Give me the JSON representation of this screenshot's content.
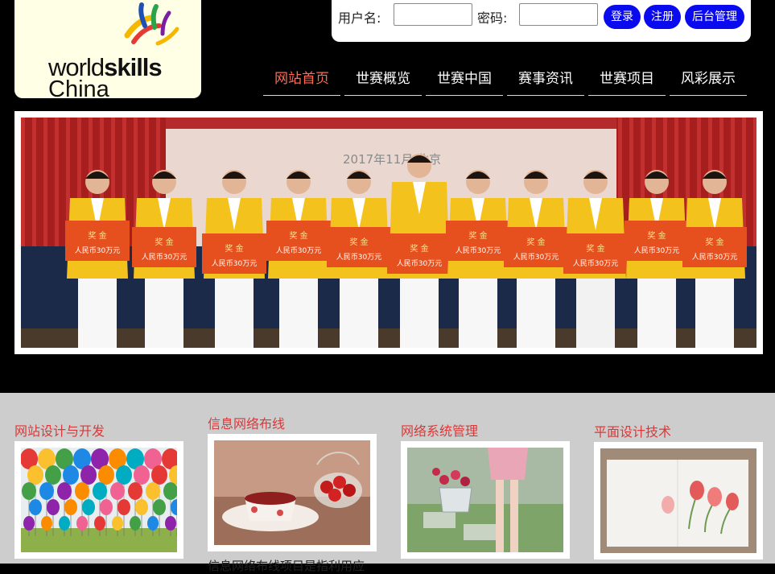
{
  "logo": {
    "word1": "world",
    "word2": "skills",
    "word3": "China"
  },
  "login": {
    "username_label": "用户名:",
    "password_label": "密码:",
    "username_value": "",
    "password_value": "",
    "login_button": "登录",
    "register_button": "注册",
    "admin_button": "后台管理"
  },
  "nav": {
    "items": [
      {
        "label": "网站首页",
        "active": true
      },
      {
        "label": "世赛概览",
        "active": false
      },
      {
        "label": "世赛中国",
        "active": false
      },
      {
        "label": "赛事资讯",
        "active": false
      },
      {
        "label": "世赛项目",
        "active": false
      },
      {
        "label": "风彩展示",
        "active": false
      }
    ]
  },
  "banner": {
    "backdrop_date": "2017年11月 北京",
    "board_title": "奖 金",
    "board_amount": "人民币30万元"
  },
  "projects": [
    {
      "title": "网站设计与开发"
    },
    {
      "title": "信息网络布线",
      "desc": "信息网络布线项目是指利用应"
    },
    {
      "title": "网络系统管理"
    },
    {
      "title": "平面设计技术"
    }
  ],
  "colors": {
    "nav_active": "#ff6a55",
    "button_blue": "#0a0aee",
    "project_title": "#d73a3a",
    "bottom_bg": "#cdcdcd"
  }
}
